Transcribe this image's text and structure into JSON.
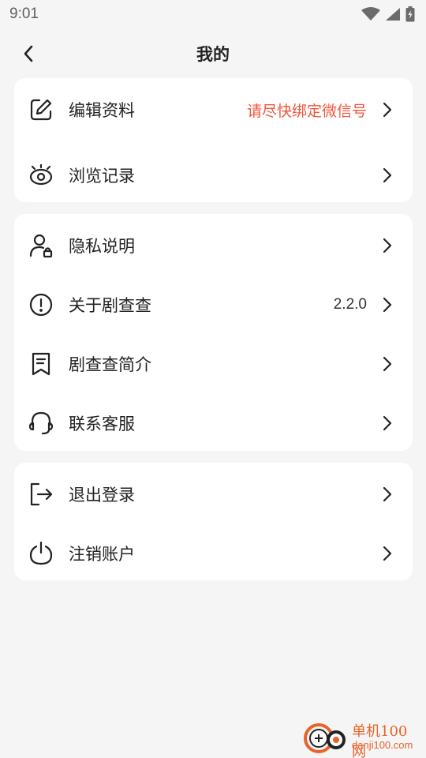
{
  "status_bar": {
    "time": "9:01"
  },
  "header": {
    "title": "我的"
  },
  "cards": [
    {
      "items": [
        {
          "label": "编辑资料",
          "right_text": "请尽快绑定微信号",
          "icon": "edit-icon"
        },
        {
          "label": "浏览记录",
          "right_text": "",
          "icon": "eye-icon"
        }
      ]
    },
    {
      "items": [
        {
          "label": "隐私说明",
          "right_text": "",
          "icon": "user-lock-icon"
        },
        {
          "label": "关于剧查查",
          "right_text": "2.2.0",
          "icon": "info-icon"
        },
        {
          "label": "剧查查简介",
          "right_text": "",
          "icon": "bookmark-icon"
        },
        {
          "label": "联系客服",
          "right_text": "",
          "icon": "headset-icon"
        }
      ]
    },
    {
      "items": [
        {
          "label": "退出登录",
          "right_text": "",
          "icon": "logout-icon"
        },
        {
          "label": "注销账户",
          "right_text": "",
          "icon": "power-icon"
        }
      ]
    }
  ],
  "colors": {
    "accent": "#f0553c",
    "background": "#f5f5f5",
    "card": "#ffffff"
  },
  "watermark": {
    "line1": "单机100网",
    "line2": "danji100.com"
  }
}
